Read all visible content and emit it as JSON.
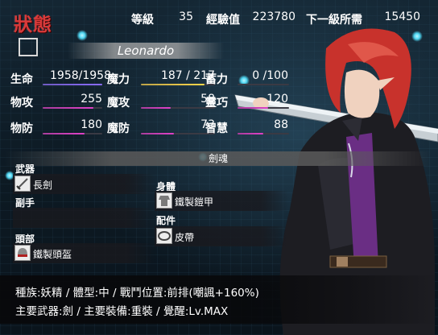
{
  "header": {
    "title": "狀態",
    "level_label": "等級",
    "level_value": "35",
    "exp_label": "經驗值",
    "exp_value": "223780",
    "next_label": "下一級所需",
    "next_value": "15450"
  },
  "character": {
    "name": "Leonardo"
  },
  "stats": [
    {
      "label": "生命",
      "value": "1958/1958",
      "fill": 1.0,
      "color": "#8a6cff"
    },
    {
      "label": "魔力",
      "value": "187 / 217",
      "fill": 0.86,
      "color": "#ffd84a"
    },
    {
      "label": "蓄力",
      "value": "0 /100",
      "fill": 0.0,
      "color": "#9a9a9a"
    },
    {
      "label": "物攻",
      "value": "255",
      "fill": 0.85,
      "color": "#e040c8"
    },
    {
      "label": "魔攻",
      "value": "58",
      "fill": 0.4,
      "color": "#e040c8"
    },
    {
      "label": "靈巧",
      "value": "120",
      "fill": 0.6,
      "color": "#e040c8"
    },
    {
      "label": "物防",
      "value": "180",
      "fill": 0.7,
      "color": "#e040c8"
    },
    {
      "label": "魔防",
      "value": "73",
      "fill": 0.45,
      "color": "#e040c8"
    },
    {
      "label": "智慧",
      "value": "88",
      "fill": 0.5,
      "color": "#e040c8"
    }
  ],
  "equipment": {
    "section_title": "劍魂",
    "weapon_label": "武器",
    "weapon_item": "長劍",
    "weapon_icon": "sword-icon",
    "offhand_label": "副手",
    "offhand_item": "",
    "head_label": "頭部",
    "head_item": "鐵製頭盔",
    "head_icon": "helmet-icon",
    "body_label": "身體",
    "body_item": "鐵製鎧甲",
    "body_icon": "armor-icon",
    "accessory_label": "配件",
    "accessory_item": "皮帶",
    "accessory_icon": "belt-icon"
  },
  "info": {
    "line1": "種族:妖精 / 體型:中 / 戰鬥位置:前排(嘲諷+160%)",
    "line2": "主要武器:劍 / 主要裝備:重裝 / 覺醒:Lv.MAX"
  },
  "colors": {
    "title": "#d93a3a",
    "hair": "#c8322c",
    "coat": "#1d1d22",
    "shirt": "#6a2e84"
  }
}
